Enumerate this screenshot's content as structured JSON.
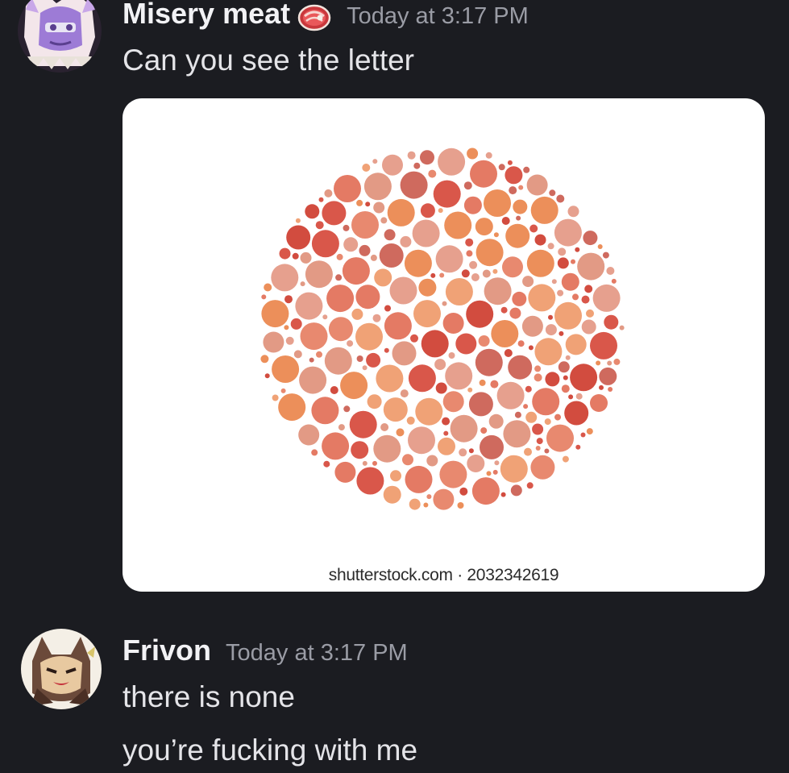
{
  "messages": [
    {
      "username": "Misery meat",
      "role_icon": "meat-icon",
      "timestamp": "Today at 3:17 PM",
      "lines": [
        "Can you see the letter"
      ],
      "attachment": {
        "type": "image",
        "description_icon": "color-blindness-test-plate",
        "watermark": "shutterstock.com · 2032342619"
      }
    },
    {
      "username": "Frivon",
      "timestamp": "Today at 3:17 PM",
      "lines": [
        "there is none",
        "you’re fucking with me"
      ]
    }
  ],
  "colors": {
    "background": "#1b1c21",
    "username": "#f2f2f5",
    "timestamp": "#9a9ca5",
    "message_text": "#e4e4e8",
    "plate_palette": [
      "#e8896f",
      "#e29a85",
      "#d9574a",
      "#ec8f5a",
      "#e6a08e",
      "#d24c3f",
      "#f0a276",
      "#cf6a5e",
      "#e47a64"
    ]
  }
}
